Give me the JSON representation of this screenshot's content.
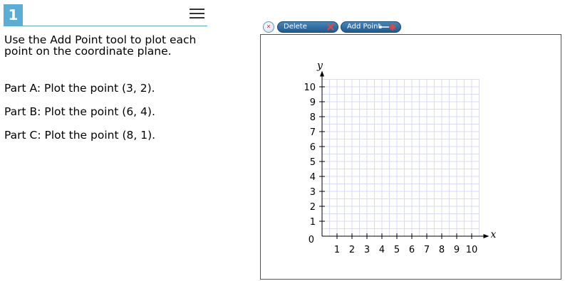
{
  "question": {
    "number": "1",
    "prompt": "Use the Add Point tool to plot each point on the coordinate plane.",
    "parts": [
      "Part A: Plot the point (3, 2).",
      "Part B: Plot the point (6, 4).",
      "Part C: Plot the point (8, 1)."
    ]
  },
  "toolbar": {
    "delete_label": "Delete",
    "add_point_label": "Add Point"
  },
  "chart_data": {
    "type": "scatter",
    "xlabel": "x",
    "ylabel": "y",
    "xlim": [
      0,
      10
    ],
    "ylim": [
      0,
      10
    ],
    "x_ticks": [
      "1",
      "2",
      "3",
      "4",
      "5",
      "6",
      "7",
      "8",
      "9",
      "10"
    ],
    "y_ticks": [
      "1",
      "2",
      "3",
      "4",
      "5",
      "6",
      "7",
      "8",
      "9",
      "10"
    ],
    "origin_label": "0",
    "grid": true,
    "points": []
  },
  "colors": {
    "accent": "#5aaed6",
    "button": "#2e6ea6",
    "grid": "#d9dafa",
    "reset_x": "#d0352f",
    "add_point_star": "#e8463c"
  }
}
